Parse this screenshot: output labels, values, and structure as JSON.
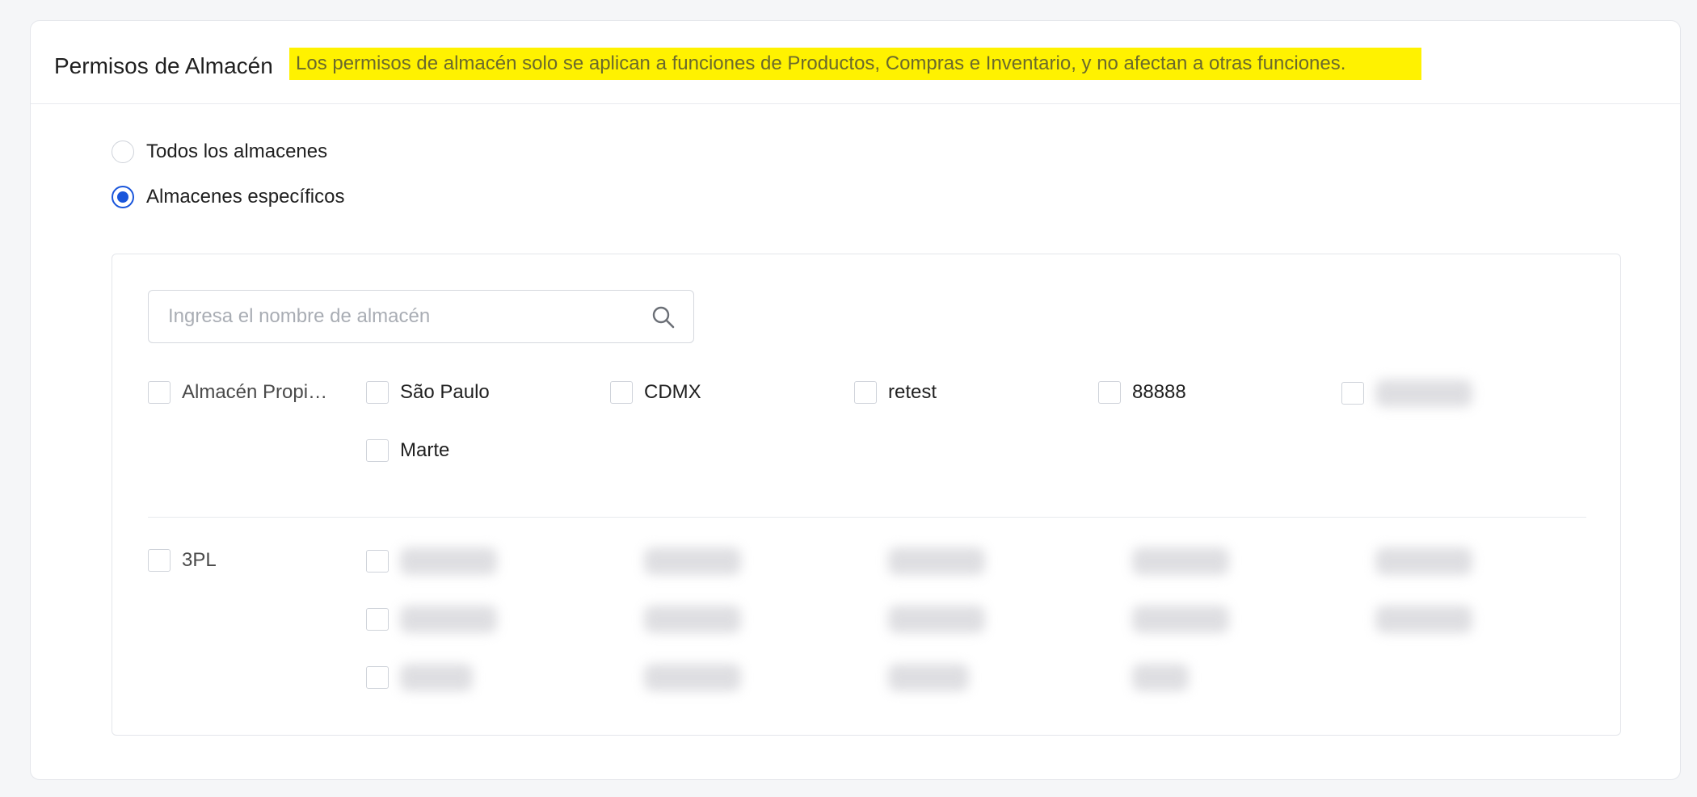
{
  "section": {
    "title": "Permisos de Almacén",
    "notice": "Los permisos de almacén solo se aplican a funciones de Productos, Compras e Inventario, y no afectan a otras funciones."
  },
  "scope": {
    "options": [
      {
        "label": "Todos los almacenes",
        "selected": false
      },
      {
        "label": "Almacenes específicos",
        "selected": true
      }
    ]
  },
  "search": {
    "placeholder": "Ingresa el nombre de almacén",
    "value": ""
  },
  "groups": [
    {
      "label": "Almacén Propi…",
      "items": [
        "São Paulo",
        "CDMX",
        "retest",
        "88888",
        "",
        "Marte"
      ]
    },
    {
      "label": "3PL",
      "items": [
        "",
        "",
        "",
        "",
        "",
        "",
        "",
        "",
        "",
        "",
        "",
        "",
        "",
        ""
      ]
    }
  ],
  "colors": {
    "accent": "#1a56db",
    "notice_bg": "#fff200"
  },
  "icons": {
    "search": "search-icon"
  }
}
